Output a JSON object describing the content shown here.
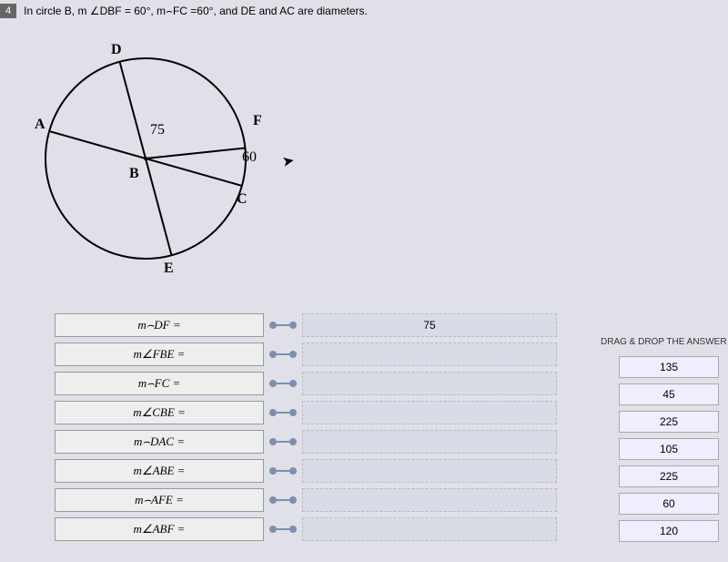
{
  "header": {
    "badge": "4",
    "text": "In circle B, m ∠DBF = 60°, m⌢FC =60°, and DE and AC are diameters."
  },
  "diagram": {
    "labels": {
      "A": "A",
      "B": "B",
      "C": "C",
      "D": "D",
      "E": "E",
      "F": "F"
    },
    "angle1": "75",
    "angle2": "60"
  },
  "rows": [
    {
      "label": "m⌢DF =",
      "value": "75"
    },
    {
      "label": "m∠FBE =",
      "value": ""
    },
    {
      "label": "m⌢FC =",
      "value": ""
    },
    {
      "label": "m∠CBE =",
      "value": ""
    },
    {
      "label": "m⌢DAC =",
      "value": ""
    },
    {
      "label": "m∠ABE =",
      "value": ""
    },
    {
      "label": "m⌢AFE =",
      "value": ""
    },
    {
      "label": "m∠ABF =",
      "value": ""
    }
  ],
  "bank": {
    "title": "DRAG & DROP THE ANSWER",
    "items": [
      "135",
      "45",
      "225",
      "105",
      "225",
      "60",
      "120"
    ]
  }
}
